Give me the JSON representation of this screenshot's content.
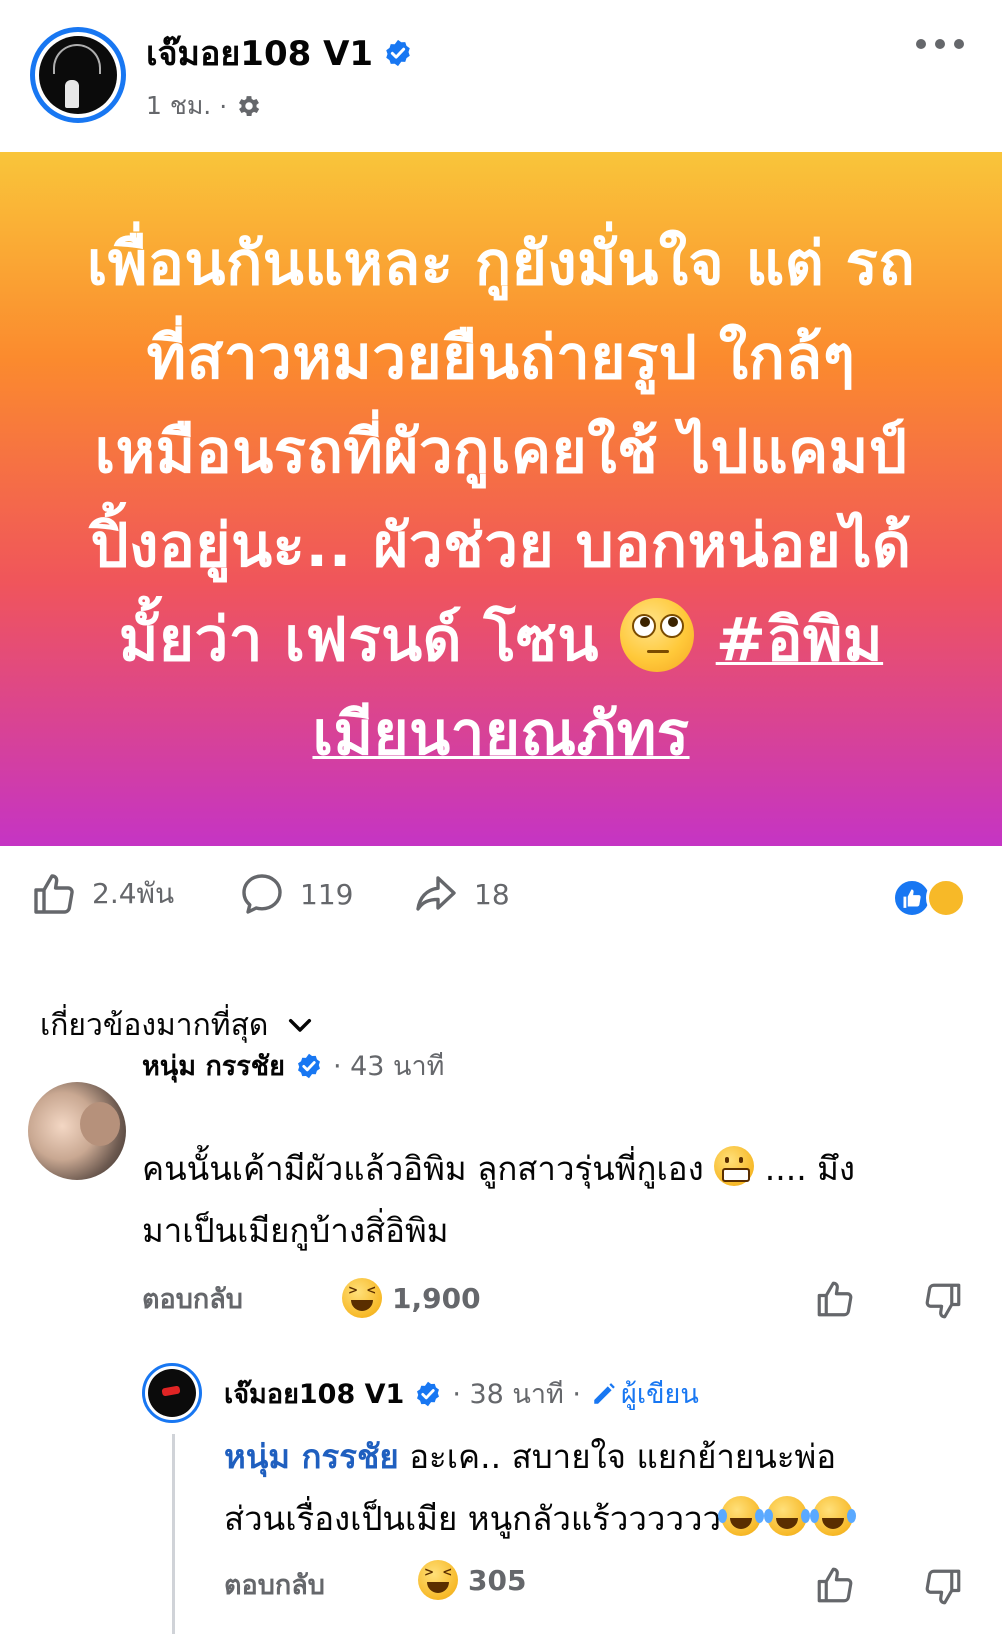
{
  "post": {
    "page_name": "เจ๊มอย108 V1",
    "time": "1 ชม.",
    "meta_separator": "·",
    "text_main": "เพื่อนกันแหละ กูยังมั่นใจ แต่ รถที่สาวหมวยยืนถ่ายรูป ใกล้ๆ เหมือนรถที่ผัวกูเคยใช้ ไปแคมป์ปิ้งอยู่นะ.. ผัวช่วย บอกหน่อยได้มั้ยว่า เฟรนด์ โซน",
    "hashtag": "#อิพิมเมียนายณภัทร",
    "background_gradient": [
      "#f9c53a",
      "#fb8a2e",
      "#f0555b",
      "#c534c4"
    ]
  },
  "actions": {
    "likes": "2.4พัน",
    "comments": "119",
    "shares": "18"
  },
  "sort_label": "เกี่ยวข้องมากที่สุด",
  "comments": [
    {
      "name": "หนุ่ม กรรชัย",
      "time": "· 43 นาที",
      "text_part1": "คนนั้นเค้ามีผัวแล้วอิพิม ลูกสาวรุ่นพี่กูเอง",
      "text_part2": ".... มึง",
      "text_line2": "มาเป็นเมียกูบ้างสิ่อิพิม",
      "reply_label": "ตอบกลับ",
      "reaction_count": "1,900"
    }
  ],
  "reply": {
    "name": "เจ๊มอย108 V1",
    "time": "· 38 นาที ·",
    "author_badge": "ผู้เขียน",
    "mention": "หนุ่ม กรรชัย",
    "text_line1": "อะเค.. สบายใจ แยกย้ายนะพ่อ",
    "text_line2": "ส่วนเรื่องเป็นเมีย หนูกลัวแร้วววววว",
    "reply_label": "ตอบกลับ",
    "reaction_count": "305"
  },
  "colors": {
    "brand_blue": "#1877f2",
    "secondary_text": "#65676b",
    "mention_blue": "#1f5fbf"
  },
  "icons": [
    "verified-icon",
    "gear-icon",
    "more-icon",
    "like-icon",
    "comment-icon",
    "share-icon",
    "chevron-down-icon",
    "dislike-icon",
    "pencil-icon"
  ]
}
